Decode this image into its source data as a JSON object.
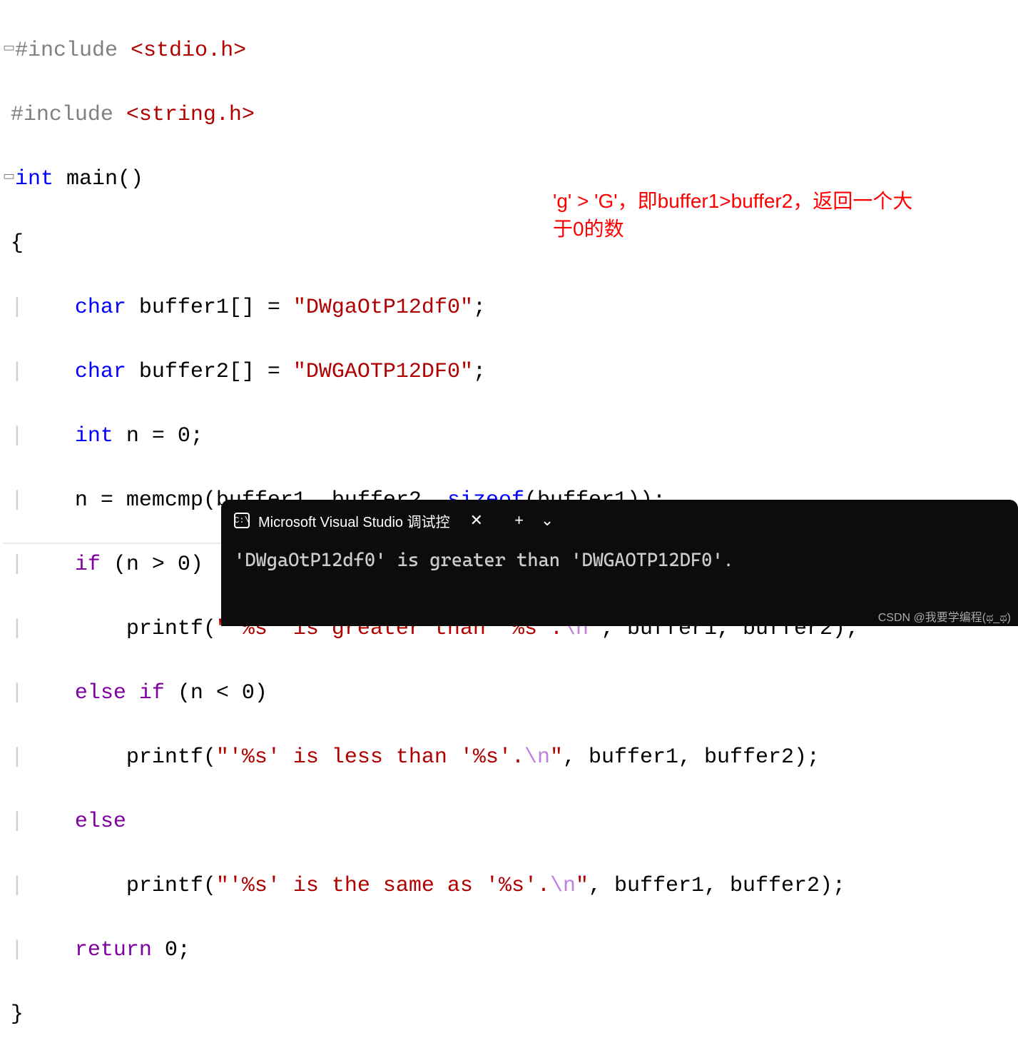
{
  "code": {
    "l1_pre": "#include ",
    "l1_path": "<stdio.h>",
    "l2_pre": "#include ",
    "l2_path": "<string.h>",
    "l3_type": "int",
    "l3_main": " main()",
    "l4_brace": "{",
    "l5_indent": "    ",
    "l5_type": "char",
    "l5_var": " buffer1[] = ",
    "l5_str": "\"DWgaOtP12df0\"",
    "l5_semi": ";",
    "l6_indent": "    ",
    "l6_type": "char",
    "l6_var": " buffer2[] = ",
    "l6_str": "\"DWGAOTP12DF0\"",
    "l6_semi": ";",
    "l7_indent": "    ",
    "l7_type": "int",
    "l7_rest": " n = 0;",
    "l8_indent": "    n = memcmp(buffer1, buffer2, ",
    "l8_sizeof": "sizeof",
    "l8_rest": "(buffer1));",
    "l9_indent": "    ",
    "l9_if": "if",
    "l9_rest": " (n > 0)",
    "l10_indent": "        printf(",
    "l10_str1": "\"'%s' is greater than '%s'.",
    "l10_esc": "\\n",
    "l10_str2": "\"",
    "l10_rest": ", buffer1, buffer2);",
    "l11_indent": "    ",
    "l11_else": "else",
    "l11_sp": " ",
    "l11_if": "if",
    "l11_rest": " (n < 0)",
    "l12_indent": "        printf(",
    "l12_str1": "\"'%s' is less than '%s'.",
    "l12_esc": "\\n",
    "l12_str2": "\"",
    "l12_rest": ", buffer1, buffer2);",
    "l13_indent": "    ",
    "l13_else": "else",
    "l14_indent": "        printf(",
    "l14_str1": "\"'%s' is the same as '%s'.",
    "l14_esc": "\\n",
    "l14_str2": "\"",
    "l14_rest": ", buffer1, buffer2);",
    "l15_indent": "    ",
    "l15_return": "return",
    "l15_rest": " 0;",
    "l16_brace": "}"
  },
  "annotation": {
    "line1": "'g' > 'G'，即buffer1>buffer2，返回一个大",
    "line2": "于0的数"
  },
  "terminal": {
    "tab_title": "Microsoft Visual Studio 调试控",
    "tab_icon_text": "C:\\",
    "close_glyph": "✕",
    "plus_glyph": "+",
    "chevron_glyph": "⌄",
    "output": "'DWgaOtP12df0' is greater than 'DWGAOTP12DF0'."
  },
  "watermark": "CSDN @我要学编程(ಥ_ಥ)"
}
